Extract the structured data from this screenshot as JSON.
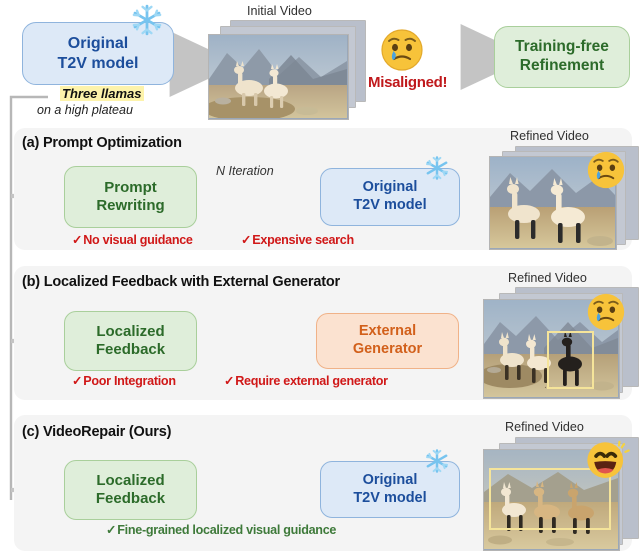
{
  "figure": {
    "top_row": {
      "model_box": {
        "line1": "Original",
        "line2": "T2V model",
        "icon": "snowflake-icon",
        "fill": "#dde9f7",
        "text_color": "#1c4e9c"
      },
      "prompt": {
        "highlight": "Three llamas",
        "rest": "on a high plateau"
      },
      "initial_video_label": "Initial Video",
      "misaligned_label": "Misaligned!",
      "misaligned_color": "#c0191c",
      "sad_emoji": "crying-face-emoji",
      "refinement_box": {
        "line1": "Training-free",
        "line2": "Refinement",
        "fill": "#dfeeda",
        "text_color": "#2c6b2a"
      }
    },
    "panels": [
      {
        "id": "a",
        "title": "(a) Prompt Optimization",
        "block1": {
          "line1": "Prompt",
          "line2": "Rewriting",
          "style": "green"
        },
        "block2": {
          "line1": "Original",
          "line2": "T2V model",
          "style": "blue",
          "icon": "snowflake-icon"
        },
        "middle_label": "N Iteration",
        "video_label": "Refined Video",
        "emoji": "crying-face-emoji",
        "checks": [
          {
            "mark": "✓",
            "text": "No visual guidance",
            "color": "#d01818"
          },
          {
            "mark": "✓",
            "text": "Expensive search",
            "color": "#d01818"
          }
        ]
      },
      {
        "id": "b",
        "title": "(b) Localized Feedback with External Generator",
        "block1": {
          "line1": "Localized",
          "line2": "Feedback",
          "style": "green"
        },
        "block2": {
          "line1": "External",
          "line2": "Generator",
          "style": "orange"
        },
        "middle_label": "",
        "video_label": "Refined Video",
        "emoji": "crying-face-emoji",
        "checks": [
          {
            "mark": "✓",
            "text": "Poor Integration",
            "color": "#d01818"
          },
          {
            "mark": "✓",
            "text": "Require external generator",
            "color": "#d01818"
          }
        ]
      },
      {
        "id": "c",
        "title": "(c) VideoRepair (Ours)",
        "block1": {
          "line1": "Localized",
          "line2": "Feedback",
          "style": "green"
        },
        "block2": {
          "line1": "Original",
          "line2": "T2V model",
          "style": "blue",
          "icon": "snowflake-icon"
        },
        "middle_label": "",
        "video_label": "Refined Video",
        "emoji": "grinning-face-emoji",
        "checks": [
          {
            "mark": "✓",
            "text": "Fine-grained localized visual guidance",
            "color": "#3e7a3a"
          }
        ]
      }
    ],
    "colors": {
      "panel_bg": "#f4f4f4",
      "arrow_gray": "#c4c4c4",
      "blue_fill": "#dde9f7",
      "green_fill": "#dfeeda",
      "orange_fill": "#fbe2d0",
      "highlight_yellow": "#fdf3ab",
      "bbox_yellow": "#f5e49a"
    }
  }
}
